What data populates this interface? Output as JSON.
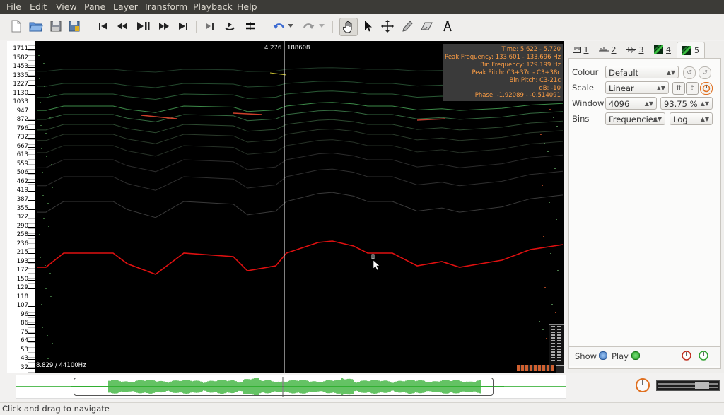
{
  "menu": [
    "File",
    "Edit",
    "View",
    "Pane",
    "Layer",
    "Transform",
    "Playback",
    "Help"
  ],
  "pane": {
    "playhead_time": "4.276",
    "playhead_frame": "188608",
    "bottom_label": "8.829 / 44100Hz",
    "scale_ticks": [
      "1711",
      "1582",
      "1453",
      "1335",
      "1227",
      "1130",
      "1033",
      "947",
      "872",
      "796",
      "732",
      "667",
      "613",
      "559",
      "506",
      "462",
      "419",
      "387",
      "355",
      "322",
      "290",
      "258",
      "236",
      "215",
      "193",
      "172",
      "150",
      "129",
      "118",
      "107",
      "96",
      "86",
      "75",
      "64",
      "53",
      "43",
      "32"
    ]
  },
  "readout": {
    "time": "Time: 5.622 - 5.720",
    "peak_freq": "Peak Frequency: 133.601 - 133.696 Hz",
    "bin_freq": "Bin Frequency: 129.199 Hz",
    "peak_pitch": "Peak Pitch: C3+37c - C3+38c",
    "bin_pitch": "Bin Pitch: C3-21c",
    "db": "dB: -10",
    "phase": "Phase: -1.92089 - -0.514091"
  },
  "tabs": [
    {
      "num": "1",
      "icon": "ruler-icon"
    },
    {
      "num": "2",
      "icon": "waveform-icon"
    },
    {
      "num": "3",
      "icon": "waveform-icon"
    },
    {
      "num": "4",
      "icon": "spectrogram-icon"
    },
    {
      "num": "5",
      "icon": "spectrogram-icon"
    }
  ],
  "props": {
    "colour_label": "Colour",
    "colour_value": "Default",
    "scale_label": "Scale",
    "scale_value": "Linear",
    "window_label": "Window",
    "window_value": "4096",
    "overlap_value": "93.75 %",
    "bins_label": "Bins",
    "bins_value": "Frequencies",
    "bins_scale": "Log",
    "show_label": "Show",
    "play_label": "Play"
  },
  "status": "Click and drag to navigate",
  "colors": {
    "accent_red": "#e00000",
    "readout_text": "#ff9f45",
    "waveform_green": "#22a922"
  }
}
